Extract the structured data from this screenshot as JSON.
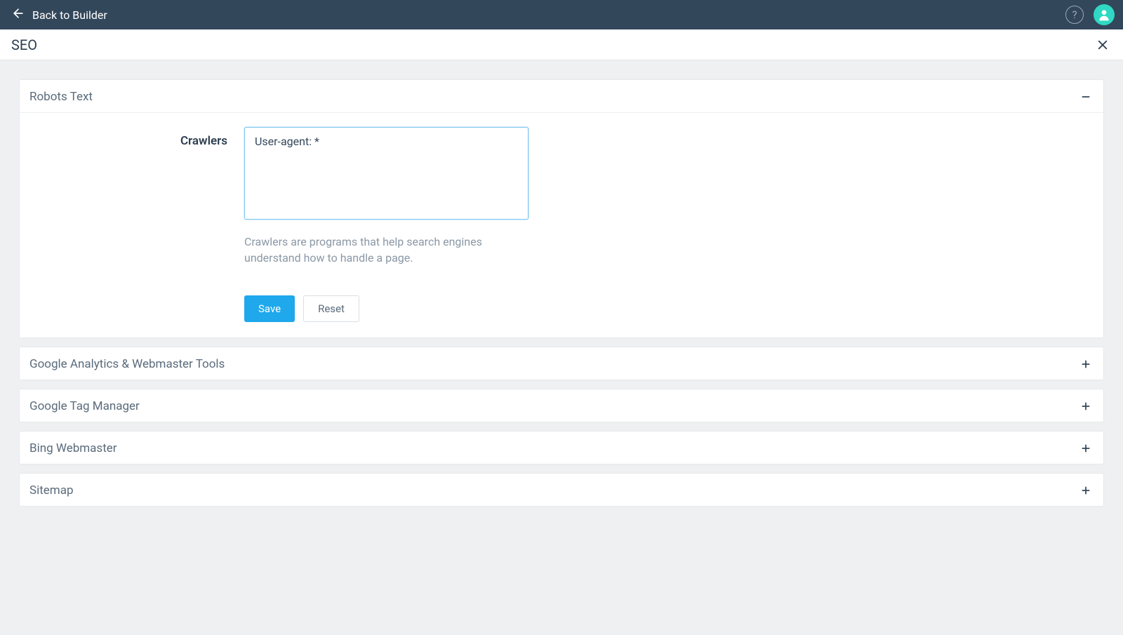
{
  "topBar": {
    "backLabel": "Back to Builder"
  },
  "pageHeader": {
    "title": "SEO"
  },
  "panels": {
    "robotsText": {
      "title": "Robots Text",
      "crawlersLabel": "Crawlers",
      "crawlersValue": "User-agent: *",
      "crawlersHelp": "Crawlers are programs that help search engines understand how to handle a page.",
      "saveLabel": "Save",
      "resetLabel": "Reset"
    },
    "googleAnalytics": {
      "title": "Google Analytics & Webmaster Tools"
    },
    "googleTagManager": {
      "title": "Google Tag Manager"
    },
    "bingWebmaster": {
      "title": "Bing Webmaster"
    },
    "sitemap": {
      "title": "Sitemap"
    }
  }
}
